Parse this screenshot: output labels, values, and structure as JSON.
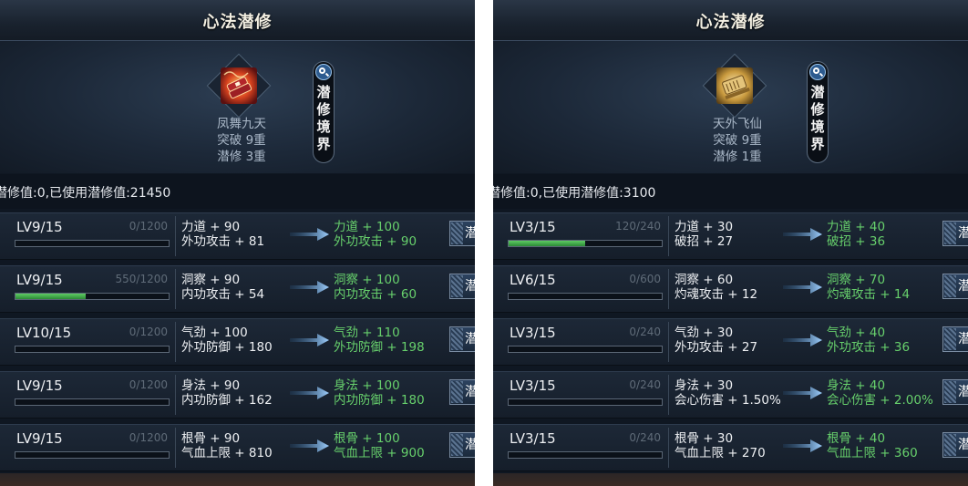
{
  "panels": [
    {
      "title": "心法潜修",
      "skill": {
        "name": "凤舞九天",
        "breakthrough": "突破 9重",
        "cultivation": "潜修 3重",
        "icon": "red-fan-scroll-icon"
      },
      "side_tag": "潜修境界",
      "summary": "潜修值:0,已使用潜修值:21450",
      "rows": [
        {
          "level": "LV9/15",
          "exp": "0/1200",
          "progress": 0.0,
          "cur1": "力道 + 90",
          "cur2": "外功攻击 + 81",
          "next1": "力道 + 100",
          "next2": "外功攻击 + 90",
          "button": "潜"
        },
        {
          "level": "LV9/15",
          "exp": "550/1200",
          "progress": 0.458,
          "cur1": "洞察 + 90",
          "cur2": "内功攻击 + 54",
          "next1": "洞察 + 100",
          "next2": "内功攻击 + 60",
          "button": "潜"
        },
        {
          "level": "LV10/15",
          "exp": "0/1200",
          "progress": 0.0,
          "cur1": "气劲 + 100",
          "cur2": "外功防御 + 180",
          "next1": "气劲 + 110",
          "next2": "外功防御 + 198",
          "button": "潜"
        },
        {
          "level": "LV9/15",
          "exp": "0/1200",
          "progress": 0.0,
          "cur1": "身法 + 90",
          "cur2": "内功防御 + 162",
          "next1": "身法 + 100",
          "next2": "内功防御 + 180",
          "button": "潜"
        },
        {
          "level": "LV9/15",
          "exp": "0/1200",
          "progress": 0.0,
          "cur1": "根骨 + 90",
          "cur2": "气血上限 + 810",
          "next1": "根骨 + 100",
          "next2": "气血上限 + 900",
          "button": "潜"
        }
      ]
    },
    {
      "title": "心法潜修",
      "skill": {
        "name": "天外飞仙",
        "breakthrough": "突破 9重",
        "cultivation": "潜修 1重",
        "icon": "golden-scroll-icon"
      },
      "side_tag": "潜修境界",
      "summary": "潜修值:0,已使用潜修值:3100",
      "rows": [
        {
          "level": "LV3/15",
          "exp": "120/240",
          "progress": 0.5,
          "cur1": "力道 + 30",
          "cur2": "破招 + 27",
          "next1": "力道 + 40",
          "next2": "破招 + 36",
          "button": "潜"
        },
        {
          "level": "LV6/15",
          "exp": "0/600",
          "progress": 0.0,
          "cur1": "洞察 + 60",
          "cur2": "灼魂攻击 + 12",
          "next1": "洞察 + 70",
          "next2": "灼魂攻击 + 14",
          "button": "潜"
        },
        {
          "level": "LV3/15",
          "exp": "0/240",
          "progress": 0.0,
          "cur1": "气劲 + 30",
          "cur2": "外功攻击 + 27",
          "next1": "气劲 + 40",
          "next2": "外功攻击 + 36",
          "button": "潜"
        },
        {
          "level": "LV3/15",
          "exp": "0/240",
          "progress": 0.0,
          "cur1": "身法 + 30",
          "cur2": "会心伤害 + 1.50%",
          "next1": "身法 + 40",
          "next2": "会心伤害 + 2.00%",
          "button": "潜"
        },
        {
          "level": "LV3/15",
          "exp": "0/240",
          "progress": 0.0,
          "cur1": "根骨 + 30",
          "cur2": "气血上限 + 270",
          "next1": "根骨 + 40",
          "next2": "气血上限 + 360",
          "button": "潜"
        }
      ]
    }
  ],
  "colors": {
    "accent_green": "#67d06c",
    "text_white": "#eef0f3",
    "panel_bg": "#0f1722",
    "arrow_blue": "#7fb6e6"
  }
}
